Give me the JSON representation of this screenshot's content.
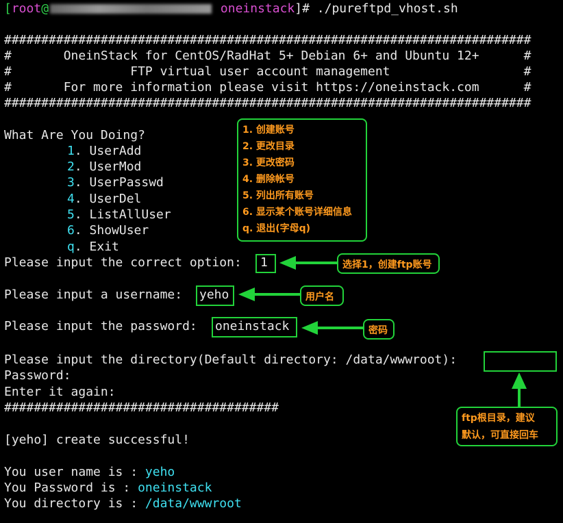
{
  "prompt": {
    "open_bracket": "[",
    "user": "root",
    "at": "@",
    "host": "oneinstack",
    "close": "]# ",
    "command": "./pureftpd_vhost.sh"
  },
  "banner": {
    "border": "#######################################################################",
    "line1": "#       OneinStack for CentOS/RadHat 5+ Debian 6+ and Ubuntu 12+      #",
    "line2": "#                FTP virtual user account management                  #",
    "line3": "#       For more information please visit https://oneinstack.com      #"
  },
  "menu": {
    "question": "What Are You Doing?",
    "items": [
      {
        "key": "1",
        "label": ". UserAdd"
      },
      {
        "key": "2",
        "label": ". UserMod"
      },
      {
        "key": "3",
        "label": ". UserPasswd"
      },
      {
        "key": "4",
        "label": ". UserDel"
      },
      {
        "key": "5",
        "label": ". ListAllUser"
      },
      {
        "key": "6",
        "label": ". ShowUser"
      },
      {
        "key": "q",
        "label": ". Exit"
      }
    ]
  },
  "session": {
    "option_prompt": "Please input the correct option:",
    "option_value": "1",
    "username_prompt": "Please input a username:",
    "username_value": "yeho",
    "password_prompt": "Please input the password:",
    "password_value": "oneinstack",
    "directory_prompt": "Please input the directory(Default directory: /data/wwwroot):",
    "password_line": "Password:",
    "again_line": "Enter it again:",
    "short_border": "#####################################",
    "success": "[yeho] create successful!",
    "result_user_label": "You user name is : ",
    "result_user_value": "yeho",
    "result_pass_label": "You Password is : ",
    "result_pass_value": "oneinstack",
    "result_dir_label": "You directory is : ",
    "result_dir_value": "/data/wwwroot"
  },
  "annotations": {
    "menu_notes": [
      "1. 创建账号",
      "2. 更改目录",
      "3. 更改密码",
      "4. 删除帐号",
      "5. 列出所有账号",
      "6. 显示某个账号详细信息",
      "q. 退出(字母q)"
    ],
    "option_note": "选择1，创建ftp账号",
    "username_note": "用户名",
    "password_note": "密码",
    "directory_note_line1": "ftp根目录，建议",
    "directory_note_line2": "默认，可直接回车"
  },
  "colors": {
    "background": "#000000",
    "text": "#e8e8e8",
    "cyan": "#3fe0f0",
    "magenta": "#d84fd0",
    "prompt_green": "#2fd04a",
    "annotation_green": "#22d33a",
    "annotation_text": "#ff9a1e"
  }
}
